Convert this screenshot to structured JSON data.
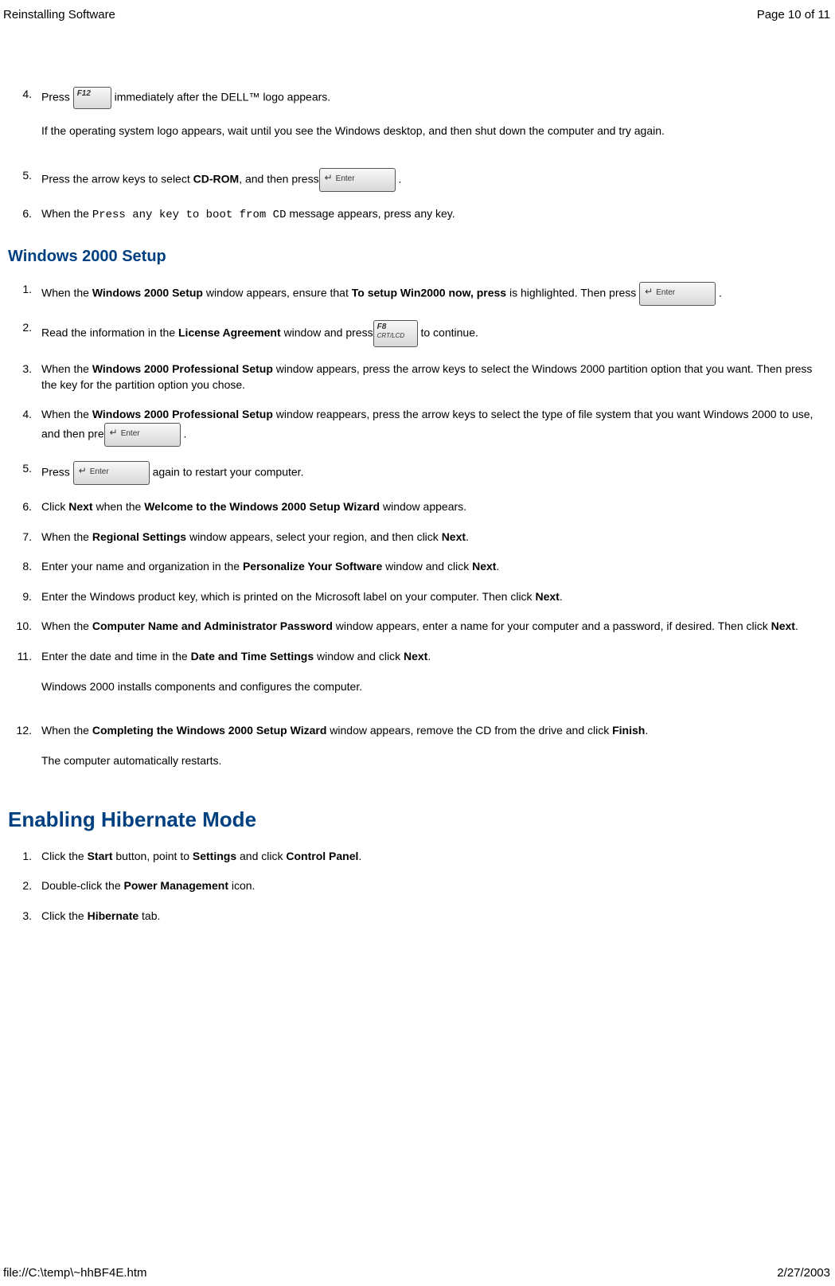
{
  "header": {
    "title": "Reinstalling Software",
    "page_info": "Page 10 of 11"
  },
  "section_top": {
    "steps": {
      "4": {
        "num": "4.",
        "pre": "Press ",
        "key_label": "F12",
        "post": " immediately after the DELL™ logo appears.",
        "sub": "If the operating system logo appears, wait until you see the Windows desktop, and then shut down the computer and try again."
      },
      "5": {
        "num": "5.",
        "pre": "Press the arrow keys to select ",
        "bold": "CD-ROM",
        "mid": ", and then press",
        "key_label": "Enter",
        "post": "  ."
      },
      "6": {
        "num": "6.",
        "pre": "When the ",
        "mono": "Press any key to boot from CD",
        "post": " message appears, press any key."
      }
    }
  },
  "section_w2k": {
    "heading": "Windows 2000 Setup",
    "steps": {
      "1": {
        "num": "1.",
        "s1": "When the ",
        "b1": "Windows 2000 Setup",
        "s2": " window appears, ensure that ",
        "b2": "To setup Win2000 now, press",
        "s3": " is highlighted. Then press ",
        "key_label": "Enter",
        "s4": "  ."
      },
      "2": {
        "num": "2.",
        "s1": "Read the information in the ",
        "b1": "License Agreement",
        "s2": " window and press",
        "key_t1": "F8",
        "key_t2": "CRT/LCD",
        "s3": " to continue."
      },
      "3": {
        "num": "3.",
        "s1": "When the ",
        "b1": "Windows 2000 Professional Setup",
        "s2": " window appears, press the arrow keys to select the Windows 2000 partition option that you want. Then press the key for the partition option you chose."
      },
      "4": {
        "num": "4.",
        "s1": "When the ",
        "b1": "Windows 2000 Professional Setup",
        "s2": " window reappears, press the arrow keys to select the type of file system that you want Windows 2000 to use, and then pre",
        "key_label": "Enter",
        "s3": "    ."
      },
      "5": {
        "num": "5.",
        "s1": "Press ",
        "key_label": "Enter",
        "s2": " again to restart your computer."
      },
      "6": {
        "num": "6.",
        "s1": "Click ",
        "b1": "Next",
        "s2": " when the ",
        "b2": "Welcome to the Windows 2000 Setup Wizard",
        "s3": " window appears."
      },
      "7": {
        "num": "7.",
        "s1": "When the ",
        "b1": "Regional Settings",
        "s2": " window appears, select your region, and then click ",
        "b2": "Next",
        "s3": "."
      },
      "8": {
        "num": "8.",
        "s1": "Enter your name and organization in the ",
        "b1": "Personalize Your Software",
        "s2": " window and click ",
        "b2": "Next",
        "s3": "."
      },
      "9": {
        "num": "9.",
        "s1": "Enter the Windows product key, which is printed on the Microsoft label on your computer. Then click ",
        "b1": "Next",
        "s2": "."
      },
      "10": {
        "num": "10.",
        "s1": "When the ",
        "b1": "Computer Name and Administrator Password",
        "s2": " window appears, enter a name for your computer and a password, if desired. Then click ",
        "b2": "Next",
        "s3": "."
      },
      "11": {
        "num": "11.",
        "s1": "Enter the date and time in the ",
        "b1": "Date and Time Settings",
        "s2": " window and click ",
        "b2": "Next",
        "s3": ".",
        "sub": "Windows 2000 installs components and configures the computer."
      },
      "12": {
        "num": "12.",
        "s1": "When the ",
        "b1": "Completing the Windows 2000 Setup Wizard",
        "s2": " window appears, remove the CD from the drive and click ",
        "b2": "Finish",
        "s3": ".",
        "sub": "The computer automatically restarts."
      }
    }
  },
  "section_hibernate": {
    "heading": "Enabling Hibernate Mode",
    "steps": {
      "1": {
        "num": "1.",
        "s1": "Click the ",
        "b1": "Start",
        "s2": " button, point to ",
        "b2": "Settings",
        "s3": " and click ",
        "b3": "Control Panel",
        "s4": "."
      },
      "2": {
        "num": "2.",
        "s1": "Double-click the ",
        "b1": "Power Management",
        "s2": " icon."
      },
      "3": {
        "num": "3.",
        "s1": "Click the ",
        "b1": "Hibernate",
        "s2": " tab."
      }
    }
  },
  "footer": {
    "path": "file://C:\\temp\\~hhBF4E.htm",
    "date": "2/27/2003"
  }
}
